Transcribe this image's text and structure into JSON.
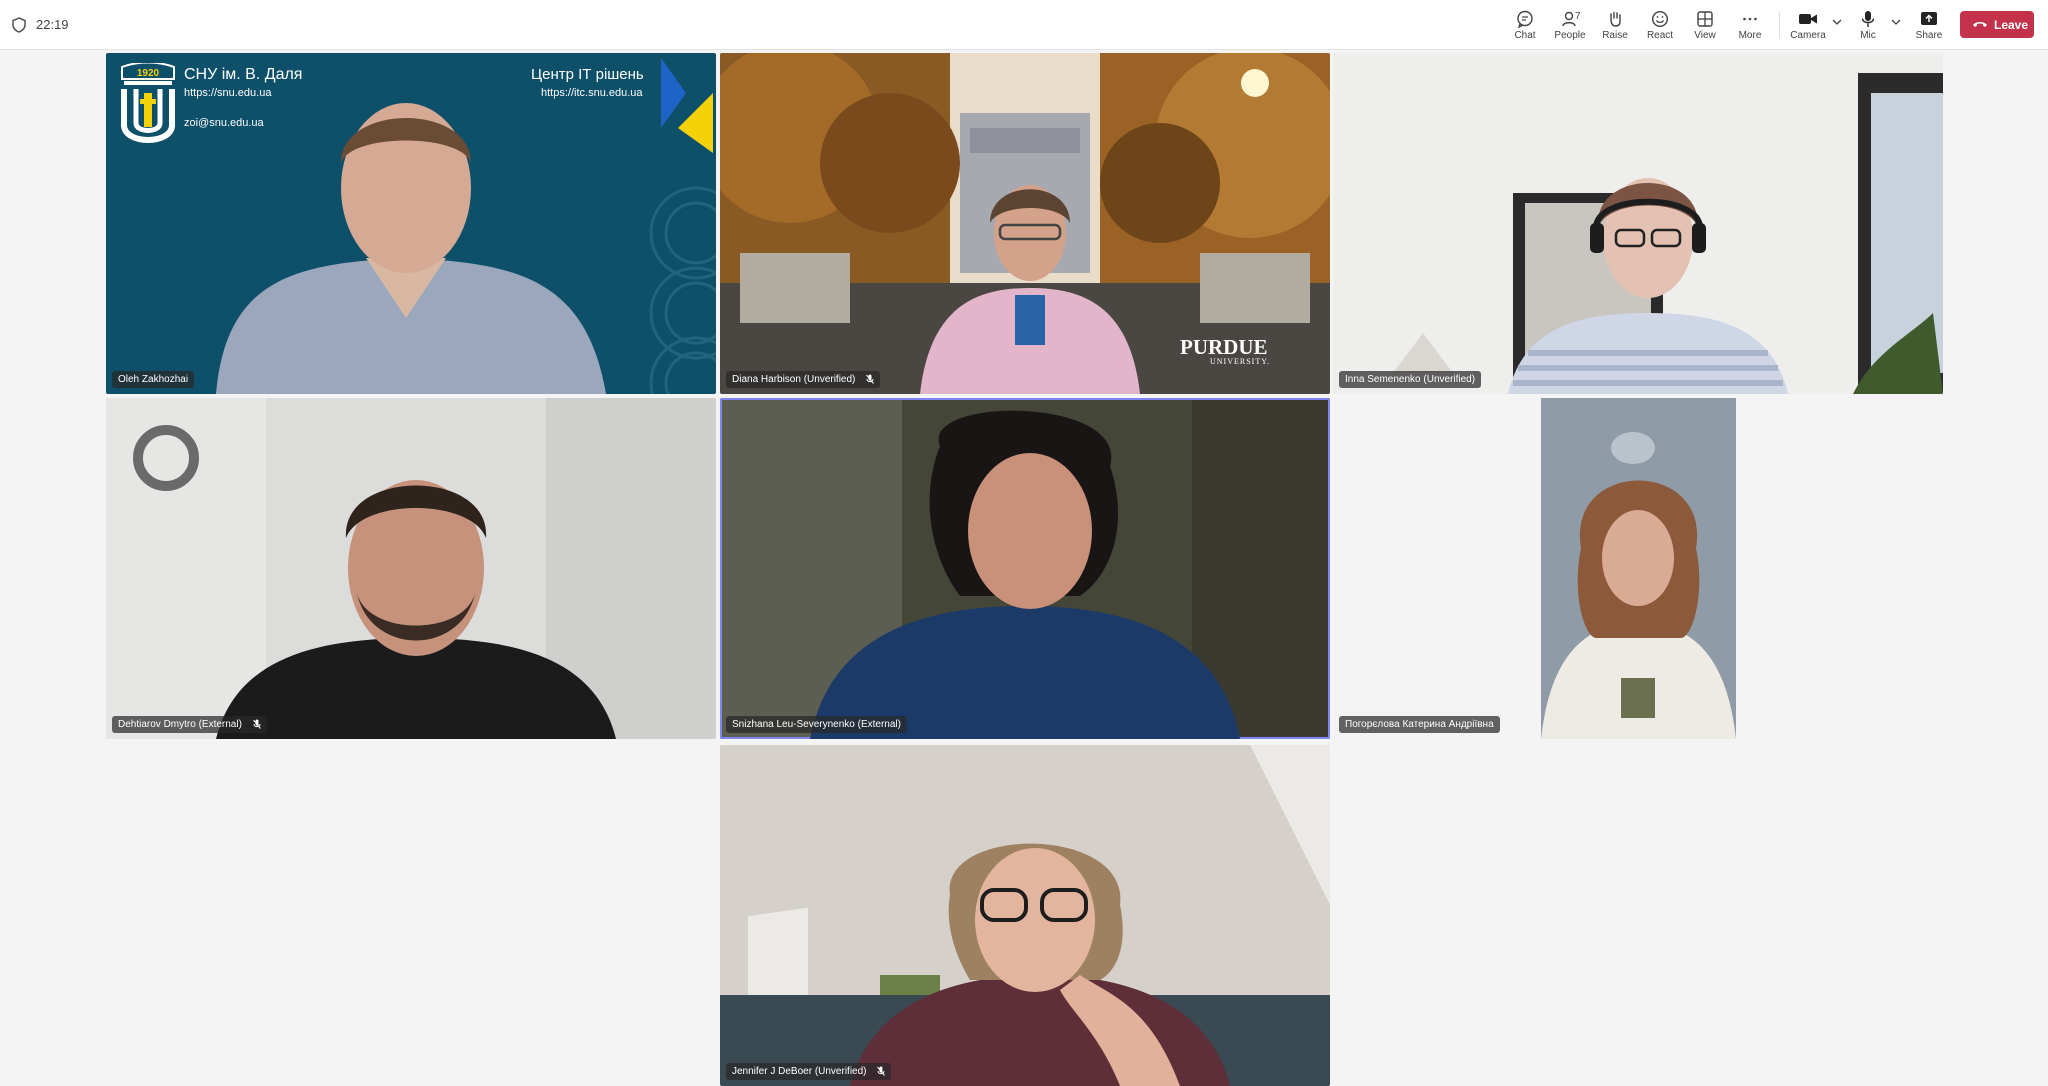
{
  "topbar": {
    "timer": "22:19",
    "chat_label": "Chat",
    "people_label": "People",
    "people_count": "7",
    "raise_label": "Raise",
    "react_label": "React",
    "view_label": "View",
    "more_label": "More",
    "camera_label": "Camera",
    "mic_label": "Mic",
    "share_label": "Share",
    "leave_label": "Leave"
  },
  "tiles": {
    "t1": {
      "name": "Oleh Zakhozhai",
      "logo_year": "1920",
      "org_title": "СНУ ім. В. Даля",
      "org_url": "https://snu.edu.ua",
      "org_email": "zoi@snu.edu.ua",
      "center_title": "Центр ІТ рішень",
      "center_url": "https://itc.snu.edu.ua"
    },
    "t2": {
      "name": "Diana Harbison (Unverified)",
      "brand": "PURDUE",
      "brand_sub": "UNIVERSITY."
    },
    "t3": {
      "name": "Inna Semenenko (Unverified)"
    },
    "t4": {
      "name": "Dehtiarov Dmytro (External)"
    },
    "t5": {
      "name": "Snizhana Leu-Severynenko (External)"
    },
    "t6": {
      "name": "Погорєлова Катерина Андріївна"
    },
    "t7": {
      "name": "Jennifer J DeBoer (Unverified)"
    }
  },
  "colors": {
    "leave_bg": "#c4314b",
    "active_speaker_border": "#7f85f5",
    "tile1_bg": "#0e4f6a",
    "flag_blue": "#1e63c6",
    "flag_yellow": "#f5d10a"
  }
}
